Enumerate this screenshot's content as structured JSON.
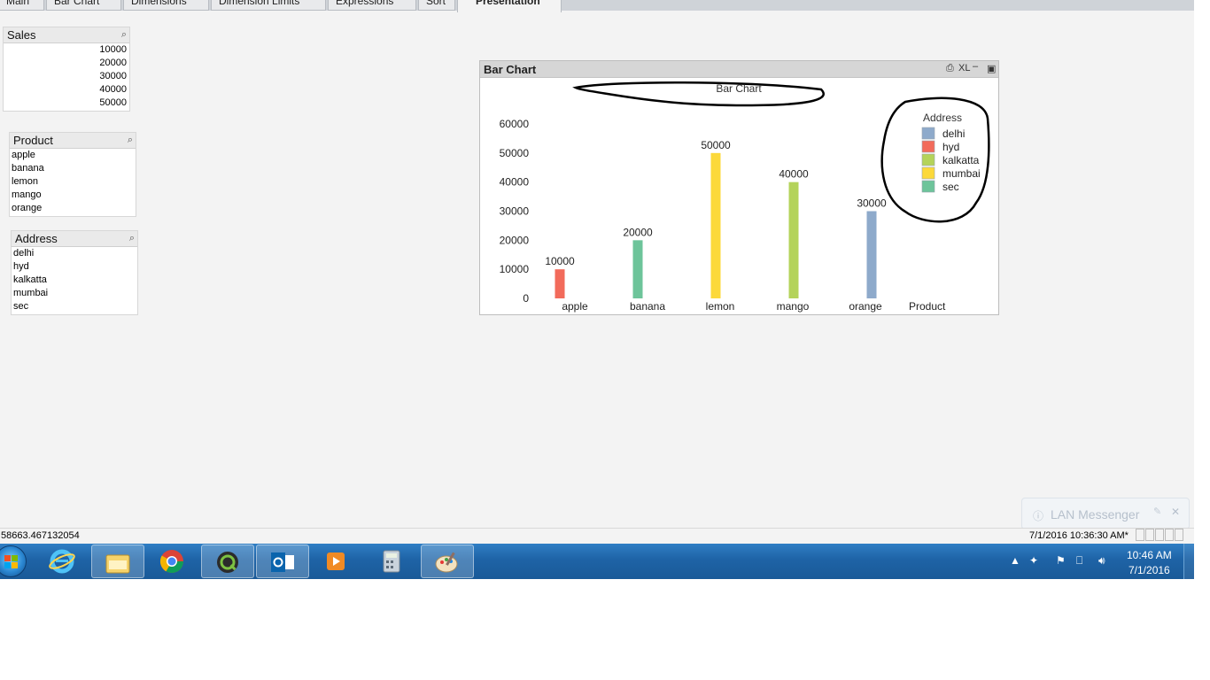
{
  "tabs": [
    "Main",
    "Bar Chart",
    "Dimensions",
    "Dimension Limits",
    "Expressions",
    "Sort",
    "Presentation"
  ],
  "listboxes": {
    "sales": {
      "title": "Sales",
      "items": [
        "10000",
        "20000",
        "30000",
        "40000",
        "50000"
      ]
    },
    "product": {
      "title": "Product",
      "items": [
        "apple",
        "banana",
        "lemon",
        "mango",
        "orange"
      ]
    },
    "address": {
      "title": "Address",
      "items": [
        "delhi",
        "hyd",
        "kalkatta",
        "mumbai",
        "sec"
      ]
    }
  },
  "chart_object": {
    "caption": "Bar Chart",
    "xl_label": "XL"
  },
  "chart_data": {
    "type": "bar",
    "title": "Bar Chart",
    "categories": [
      "apple",
      "banana",
      "lemon",
      "mango",
      "orange"
    ],
    "values": [
      10000,
      20000,
      50000,
      40000,
      30000
    ],
    "data_labels": [
      "10000",
      "20000",
      "50000",
      "40000",
      "30000"
    ],
    "bar_colors": [
      "#f26b5b",
      "#6dc49a",
      "#fcd93a",
      "#b4d35a",
      "#8eaacb"
    ],
    "xlabel": "Product",
    "ylabel": "",
    "ylim": [
      0,
      60000
    ],
    "yticks": [
      0,
      10000,
      20000,
      30000,
      40000,
      50000,
      60000
    ],
    "ytick_labels": [
      "0",
      "10000",
      "20000",
      "30000",
      "40000",
      "50000",
      "60000"
    ],
    "grid": false,
    "legend": {
      "title": "Address",
      "placement": "top-right",
      "entries": [
        {
          "name": "delhi",
          "color": "#8eaacb"
        },
        {
          "name": "hyd",
          "color": "#f26b5b"
        },
        {
          "name": "kalkatta",
          "color": "#b4d35a"
        },
        {
          "name": "mumbai",
          "color": "#fcd93a"
        },
        {
          "name": "sec",
          "color": "#6dc49a"
        }
      ]
    }
  },
  "status": {
    "left": "58663.467132054",
    "right": "7/1/2016 10:36:30 AM*"
  },
  "lan_messenger": {
    "title": "LAN Messenger"
  },
  "taskbar": {
    "apps": [
      "internet-explorer-icon",
      "file-explorer-icon",
      "chrome-icon",
      "qlikview-icon",
      "outlook-icon",
      "media-player-icon",
      "calculator-icon",
      "paint-icon"
    ],
    "time": "10:46 AM",
    "date": "7/1/2016"
  }
}
